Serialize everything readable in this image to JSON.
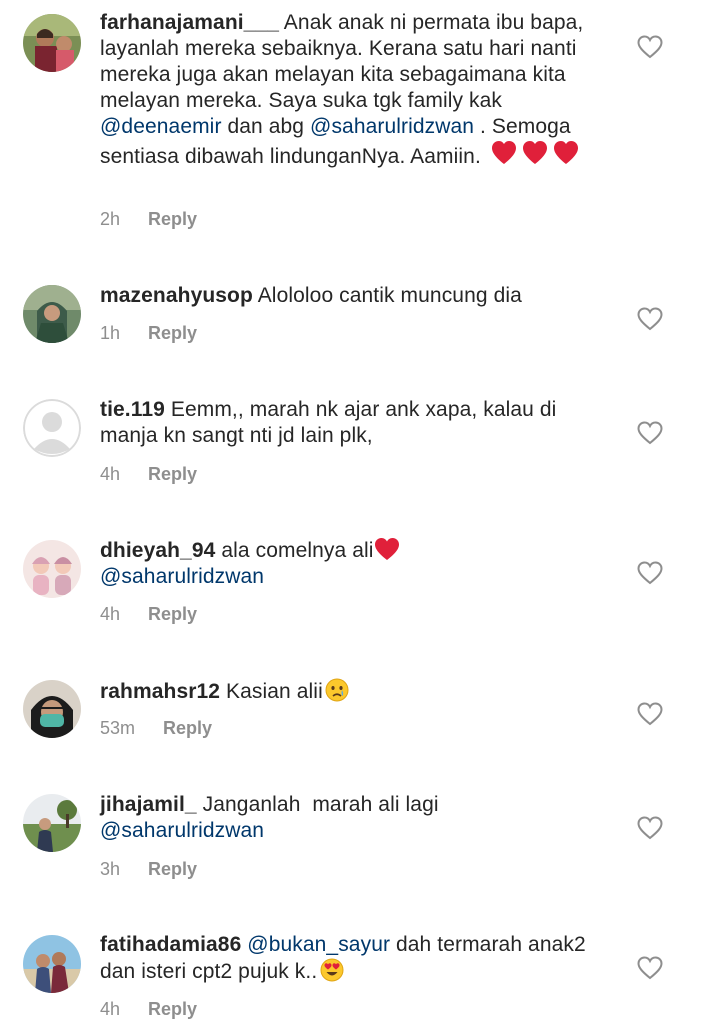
{
  "comments": [
    {
      "username": "farhanajamani___",
      "text_parts": [
        " Anak anak ni permata ibu bapa, layanlah mereka sebaiknya. Kerana satu hari nanti mereka juga akan melayan kita sebagaimana kita melayan mereka. Saya suka tgk family kak ",
        "@deenaemir",
        " dan abg ",
        "@saharulridzwan",
        " . Semoga sentiasa dibawah lindunganNya. Aamiin."
      ],
      "time": "2h",
      "reply": "Reply",
      "emoji": "three-red-hearts",
      "avatar": "photo-avatar-family"
    },
    {
      "username": "mazenahyusop",
      "text": " Alololoo cantik muncung dia",
      "time": "1h",
      "reply": "Reply",
      "avatar": "photo-avatar-woman-hijab"
    },
    {
      "username": "tie.119",
      "text": " Eemm,, marah nk ajar ank xapa, kalau di manja kn sangt nti jd lain plk,",
      "time": "4h",
      "reply": "Reply",
      "avatar": "default-avatar"
    },
    {
      "username": "dhieyah_94",
      "text": " ala comelnya ali",
      "mention": "@saharulridzwan",
      "time": "4h",
      "reply": "Reply",
      "emoji": "red-heart",
      "avatar": "illustrated-avatar"
    },
    {
      "username": "rahmahsr12",
      "text": " Kasian alii",
      "time": "53m",
      "reply": "Reply",
      "emoji": "crying-face",
      "avatar": "photo-avatar-masked"
    },
    {
      "username": "jihajamil_",
      "text": " Janganlah  marah ali lagi",
      "mention": "@saharulridzwan",
      "time": "3h",
      "reply": "Reply",
      "avatar": "photo-avatar-outdoor"
    },
    {
      "username": "fatihadamia86",
      "mention": "@bukan_sayur",
      "text": " dah termarah anak2 dan isteri cpt2 pujuk k..",
      "time": "4h",
      "reply": "Reply",
      "emoji": "heart-eyes-face",
      "avatar": "photo-avatar-beach"
    }
  ],
  "colors": {
    "text": "#262626",
    "mention": "#00376b",
    "meta": "#8e8e8e",
    "heart_emoji": "#e0203a"
  },
  "icons": {
    "like": "heart-outline-icon"
  }
}
